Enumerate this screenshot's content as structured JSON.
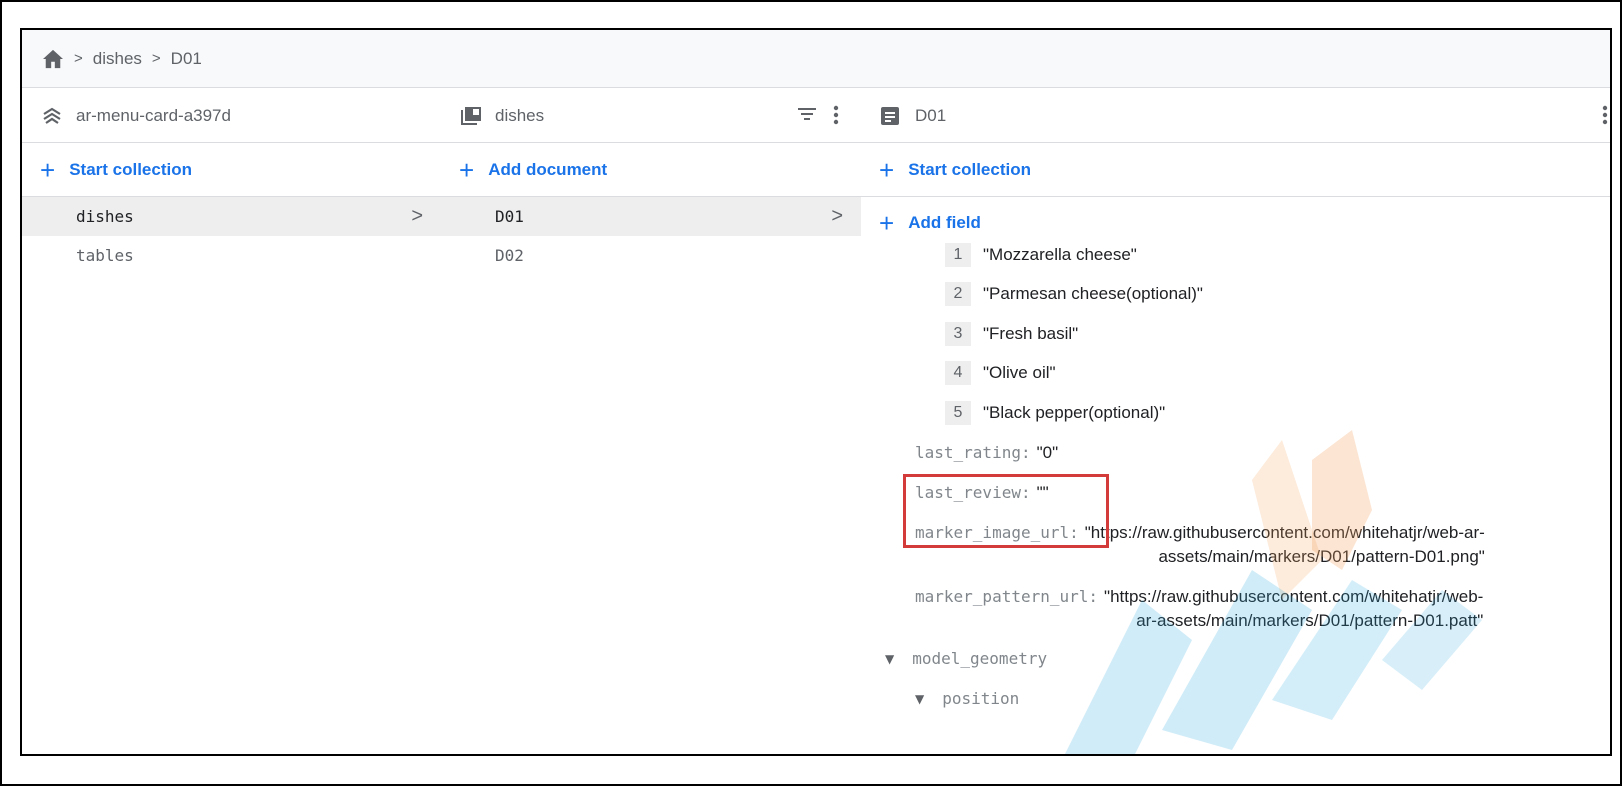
{
  "breadcrumb": {
    "home_icon": "home-icon",
    "items": [
      "dishes",
      "D01"
    ],
    "separator": ">"
  },
  "panels": {
    "root": {
      "title": "ar-menu-card-a397d",
      "add_label": "Start collection",
      "items": [
        {
          "label": "dishes",
          "selected": true
        },
        {
          "label": "tables",
          "selected": false
        }
      ]
    },
    "collection": {
      "title": "dishes",
      "add_label": "Add document",
      "items": [
        {
          "label": "D01",
          "selected": true
        },
        {
          "label": "D02",
          "selected": false
        }
      ]
    },
    "document": {
      "title": "D01",
      "add_collection_label": "Start collection",
      "add_field_label": "Add field",
      "array_items": [
        {
          "index": "1",
          "value": "\"Mozzarella cheese\""
        },
        {
          "index": "2",
          "value": "\"Parmesan cheese(optional)\""
        },
        {
          "index": "3",
          "value": "\"Fresh basil\""
        },
        {
          "index": "4",
          "value": "\"Olive oil\""
        },
        {
          "index": "5",
          "value": "\"Black pepper(optional)\""
        }
      ],
      "fields": {
        "last_rating": {
          "key": "last_rating:",
          "value": "\"0\""
        },
        "last_review": {
          "key": "last_review:",
          "value": "\"\""
        },
        "marker_image_url": {
          "key": "marker_image_url:",
          "value_line1": "\"https://raw.githubusercontent.com/whitehatjr/web-ar-",
          "value_line2": "assets/main/markers/D01/pattern-D01.png\""
        },
        "marker_pattern_url": {
          "key": "marker_pattern_url:",
          "value_line1": "\"https://raw.githubusercontent.com/whitehatjr/web-",
          "value_line2": "ar-assets/main/markers/D01/pattern-D01.patt\""
        }
      },
      "tree": {
        "model_geometry": "model_geometry",
        "position": "position"
      }
    }
  },
  "colors": {
    "accent": "#1a73e8",
    "highlight": "#d33b3b",
    "watermark_orange": "#f5a25d",
    "watermark_blue": "#29a8e0"
  }
}
